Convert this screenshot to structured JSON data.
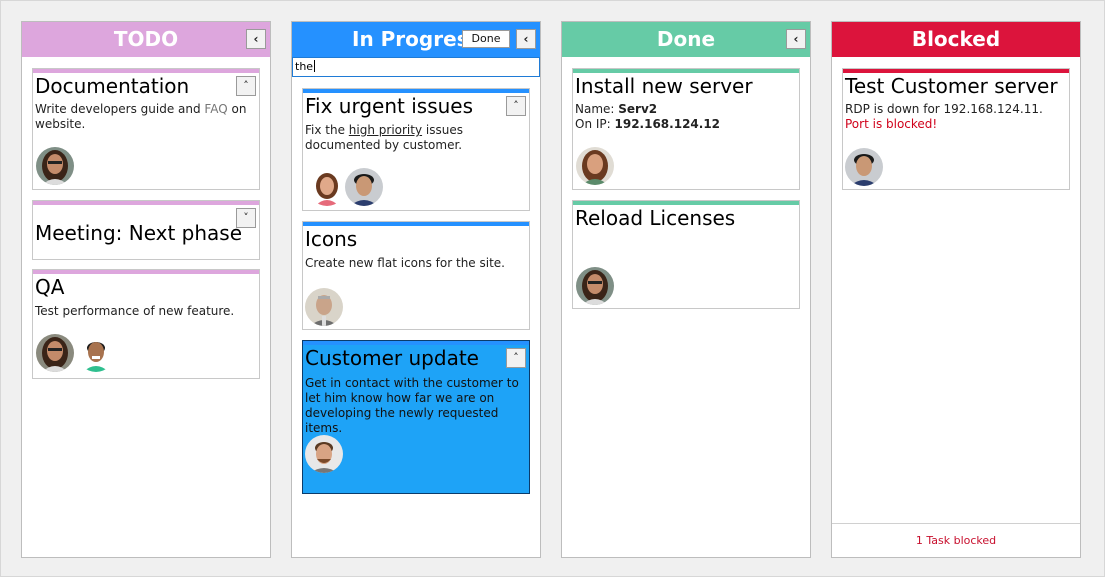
{
  "colors": {
    "todo": "#dda6dd",
    "in_progress": "#2591ff",
    "done": "#66cba6",
    "blocked": "#dc143c",
    "selected_card": "#1ea3f7"
  },
  "columns": {
    "todo": {
      "title": "TODO",
      "collapse_icon": "chevron-left-icon",
      "collapse_glyph": "‹",
      "cards": [
        {
          "title": "Documentation",
          "desc_a": "Write developers guide and ",
          "desc_link": "FAQ",
          "desc_b": " on website.",
          "button_glyph": "˄"
        },
        {
          "title": "Meeting: Next phase",
          "button_glyph": "˅"
        },
        {
          "title": "QA",
          "desc": "Test performance of new feature."
        }
      ]
    },
    "in_progress": {
      "title": "In Progress",
      "done_label": "Done",
      "collapse_glyph": "‹",
      "search_value": "the",
      "cards": [
        {
          "title": "Fix urgent issues",
          "desc_a": "Fix the ",
          "desc_link": "high priority",
          "desc_b": " issues documented by customer.",
          "button_glyph": "˄"
        },
        {
          "title": "Icons",
          "desc": "Create new flat icons for the site."
        },
        {
          "title": "Customer update",
          "desc": "Get in contact with the customer to let him know how far we are on developing the newly requested items.",
          "button_glyph": "˄"
        }
      ]
    },
    "done": {
      "title": "Done",
      "collapse_glyph": "‹",
      "cards": [
        {
          "title": "Install new server",
          "name_label": "Name: ",
          "name_value": "Serv2",
          "ip_label": "On IP: ",
          "ip_value": "192.168.124.12"
        },
        {
          "title": "Reload Licenses"
        }
      ]
    },
    "blocked": {
      "title": "Blocked",
      "cards": [
        {
          "title": "Test Customer server",
          "desc": "RDP is down for 192.168.124.11.",
          "desc_red": "Port is blocked!"
        }
      ],
      "footer": "1 Task blocked"
    }
  }
}
